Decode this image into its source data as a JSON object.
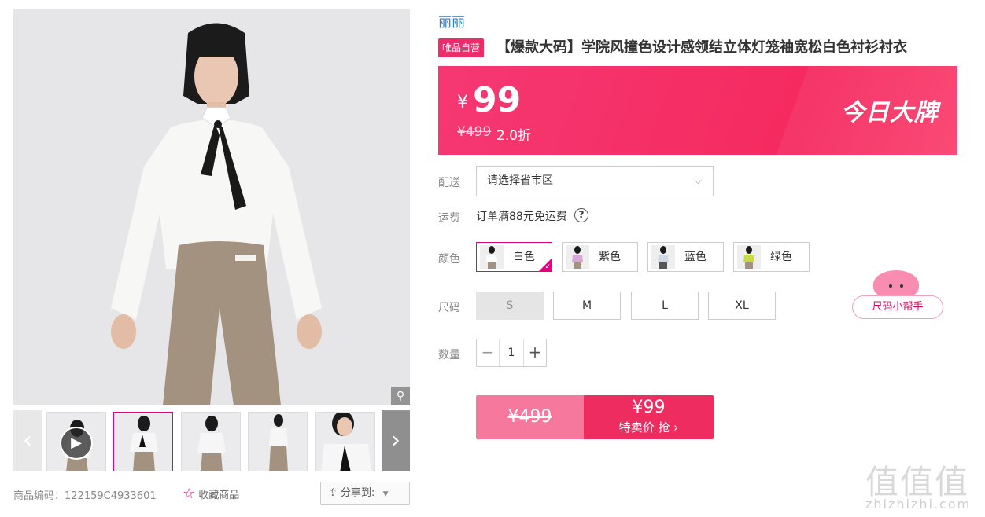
{
  "gallery": {
    "zoom_icon": "magnifier-icon",
    "prev_icon": "chevron-left-icon",
    "next_icon": "chevron-right-icon",
    "play_icon": "play-icon"
  },
  "footer": {
    "code_label": "商品编码：",
    "code_value": "122159C4933601",
    "fav_label": "收藏商品",
    "share_label": "分享到:"
  },
  "brand": "丽丽",
  "tag": "唯品自营",
  "title": "【爆款大码】学院风撞色设计感领结立体灯笼袖宽松白色衬衫衬衣",
  "price": {
    "currency": "¥",
    "value": "99",
    "original": "¥499",
    "discount": "2.0折",
    "promo": "今日大牌"
  },
  "delivery": {
    "label": "配送",
    "placeholder": "请选择省市区"
  },
  "shipping": {
    "label": "运费",
    "text": "订单满88元免运费",
    "help_icon": "question-icon"
  },
  "colors": {
    "label": "颜色",
    "options": [
      {
        "name": "白色",
        "selected": true
      },
      {
        "name": "紫色",
        "selected": false
      },
      {
        "name": "蓝色",
        "selected": false
      },
      {
        "name": "绿色",
        "selected": false
      }
    ]
  },
  "sizes": {
    "label": "尺码",
    "options": [
      "S",
      "M",
      "L",
      "XL"
    ],
    "disabled": [
      "S"
    ],
    "helper": "尺码小帮手"
  },
  "quantity": {
    "label": "数量",
    "value": "1",
    "minus": "−",
    "plus": "+"
  },
  "buy": {
    "original": "¥499",
    "price": "¥99",
    "text": "特卖价 抢"
  },
  "watermark": {
    "main": "值值值",
    "url": "zhizhizhi.com"
  },
  "colors_hex": {
    "accent": "#e4007f",
    "price_bar": "#f52a5f",
    "buy_button": "#ee2c5f"
  }
}
